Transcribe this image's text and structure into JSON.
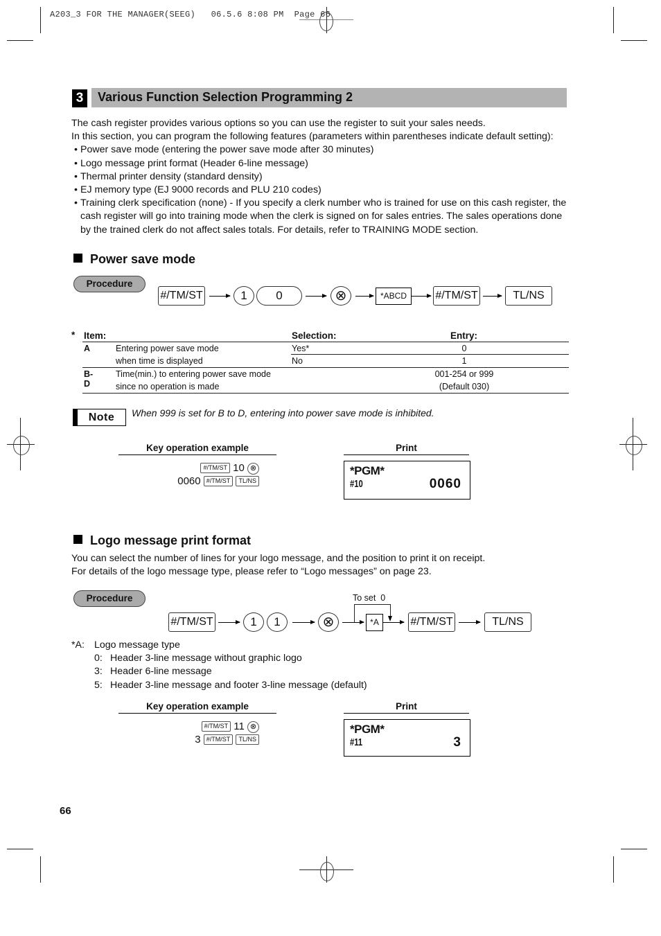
{
  "slug": {
    "job": "A203_3 FOR THE MANAGER(SEEG)",
    "datetime": "06.5.6 8:08 PM",
    "page": "Page 66"
  },
  "section": {
    "number": "3",
    "title": "Various Function Selection Programming 2"
  },
  "intro": {
    "lines": [
      "The cash register provides various options so you can use the register to suit your sales needs.",
      "In this section, you can program the following features (parameters within parentheses indicate default setting):"
    ],
    "features": [
      "Power save mode (entering the power save mode after 30 minutes)",
      "Logo message print format (Header 6-line message)",
      "Thermal printer density (standard density)",
      "EJ memory type (EJ 9000 records and PLU 210 codes)",
      "Training clerk specification (none) - If you specify a clerk number who is trained for use on this cash register, the cash register will go into training mode when the clerk is signed on for sales entries.  The sales operations done by the trained clerk do not affect sales totals.  For details, refer to TRAINING MODE section."
    ]
  },
  "power_save": {
    "heading": "Power save mode",
    "procedure_label": "Procedure",
    "keys": {
      "tmst": "#/TM/ST",
      "d1": "1",
      "d0": "0",
      "mult": "⊗",
      "abcd": "*ABCD",
      "tlns": "TL/NS"
    },
    "table": {
      "star": "*",
      "headers": {
        "item": "Item:",
        "selection": "Selection:",
        "entry": "Entry:"
      },
      "rows": [
        {
          "code": "A",
          "desc1": "Entering power save mode",
          "desc2": "when time is displayed",
          "sel1": "Yes*",
          "sel2": "No",
          "entry1": "0",
          "entry2": "1"
        },
        {
          "code": "B-D",
          "desc1": "Time(min.) to entering power save mode",
          "desc2": "since no operation is made",
          "sel1": "",
          "sel2": "",
          "entry1": "001-254 or 999",
          "entry2": "(Default 030)"
        }
      ]
    },
    "note": {
      "label": "Note",
      "text": "When 999 is set for B to D, entering into power save mode is inhibited."
    },
    "example": {
      "key_head": "Key operation example",
      "print_head": "Print",
      "line1_key": "#/TM/ST",
      "line1_num": "10",
      "line1_circ": "⊗",
      "line2_num": "0060",
      "line2_key1": "#/TM/ST",
      "line2_key2": "TL/NS",
      "print_title": "*PGM*",
      "print_code": "#10",
      "print_value": "0060"
    }
  },
  "logo": {
    "heading": "Logo message print format",
    "desc": [
      "You can select the number of lines for your logo message, and the position to print it on receipt.",
      "For details of the logo message type, please refer to “Logo messages” on page 23."
    ],
    "procedure_label": "Procedure",
    "to_set": "To set  0",
    "keys": {
      "tmst": "#/TM/ST",
      "d1a": "1",
      "d1b": "1",
      "mult": "⊗",
      "a": "*A",
      "tlns": "TL/NS"
    },
    "legend": {
      "label": "*A:",
      "title": "Logo message type",
      "options": [
        {
          "code": "0:",
          "text": "Header 3-line message without graphic logo"
        },
        {
          "code": "3:",
          "text": "Header 6-line message"
        },
        {
          "code": "5:",
          "text": "Header 3-line message and footer 3-line message (default)"
        }
      ]
    },
    "example": {
      "key_head": "Key operation example",
      "print_head": "Print",
      "line1_key": "#/TM/ST",
      "line1_num": "11",
      "line1_circ": "⊗",
      "line2_num": "3",
      "line2_key1": "#/TM/ST",
      "line2_key2": "TL/NS",
      "print_title": "*PGM*",
      "print_code": "#11",
      "print_value": "3"
    }
  },
  "page_number": "66"
}
